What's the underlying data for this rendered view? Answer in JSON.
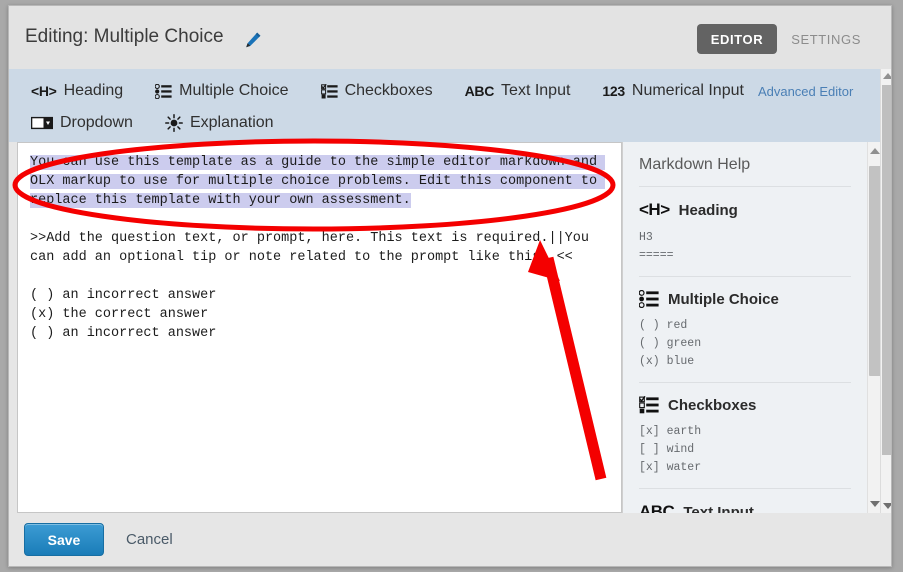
{
  "window": {
    "title_prefix": "Editing:",
    "title": "Editing: Multiple Choice",
    "pencil_icon": "pencil-icon"
  },
  "view_toggle": {
    "editor_label": "EDITOR",
    "settings_label": "SETTINGS",
    "active": "EDITOR",
    "active_bg": "#636363",
    "inactive_color": "#8c8c8c"
  },
  "toolbar": {
    "background": "#ccd9e6",
    "row1": [
      {
        "icon": "heading-icon",
        "glyph": "<H>",
        "label": "Heading"
      },
      {
        "icon": "multiple-choice-icon",
        "glyph": "",
        "label": "Multiple Choice"
      },
      {
        "icon": "checkboxes-icon",
        "glyph": "",
        "label": "Checkboxes"
      },
      {
        "icon": "text-input-icon",
        "glyph": "ABC",
        "label": "Text Input"
      },
      {
        "icon": "numerical-input-icon",
        "glyph": "123",
        "label": "Numerical Input"
      }
    ],
    "row2": [
      {
        "icon": "dropdown-icon",
        "glyph": "",
        "label": "Dropdown"
      },
      {
        "icon": "explanation-icon",
        "glyph": "",
        "label": "Explanation"
      }
    ],
    "advanced_editor_label": "Advanced Editor",
    "advanced_editor_color": "#4a7fb5"
  },
  "editor": {
    "selected_text": "You can use this template as a guide to the simple editor markdown and OLX markup to use for multiple choice problems. Edit this component to replace this template with your own assessment.",
    "selection_highlight": "#ccccee",
    "body_line_1": ">>Add the question text, or prompt, here. This text is required.||You can add an optional tip or note related to the prompt like this. <<",
    "choices": [
      "( ) an incorrect answer",
      "(x) the correct answer",
      "( ) an incorrect answer"
    ]
  },
  "help_panel": {
    "title": "Markdown Help",
    "background": "#eef1f4",
    "sections": [
      {
        "icon": "heading-icon",
        "glyph": "<H>",
        "heading": "Heading",
        "code": "H3\n====="
      },
      {
        "icon": "multiple-choice-icon",
        "glyph": "",
        "heading": "Multiple Choice",
        "code": "( ) red\n( ) green\n(x) blue"
      },
      {
        "icon": "checkboxes-icon",
        "glyph": "",
        "heading": "Checkboxes",
        "code": "[x] earth\n[ ] wind\n[x] water"
      },
      {
        "icon": "text-input-icon",
        "glyph": "ABC",
        "heading": "Text Input",
        "code": ""
      }
    ]
  },
  "footer": {
    "save_label": "Save",
    "cancel_label": "Cancel",
    "save_color": "#1a7cb8"
  },
  "annotations": {
    "highlight_color": "#f40000",
    "ellipse_name": "red-ellipse-around-selected-template-text",
    "arrow_name": "red-arrow-pointing-at-caret"
  }
}
